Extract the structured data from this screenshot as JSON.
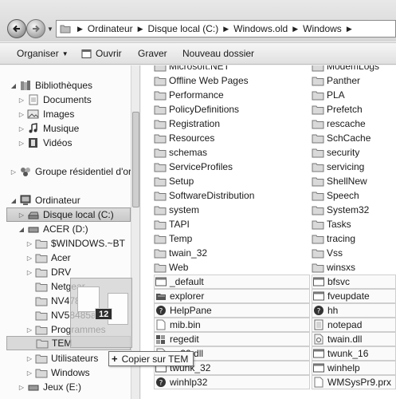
{
  "address": {
    "breadcrumbs": [
      "Ordinateur",
      "Disque local (C:)",
      "Windows.old",
      "Windows"
    ]
  },
  "toolbar": {
    "organize": "Organiser",
    "open": "Ouvrir",
    "burn": "Graver",
    "new_folder": "Nouveau dossier"
  },
  "nav": {
    "libraries": "Bibliothèques",
    "documents": "Documents",
    "images": "Images",
    "music": "Musique",
    "videos": "Vidéos",
    "homegroup": "Groupe résidentiel d'ordina",
    "computer": "Ordinateur",
    "local_disk": "Disque local (C:)",
    "acer": "ACER (D:)",
    "windows_bt": "$WINDOWS.~BT",
    "acer_folder": "Acer",
    "drv": "DRV",
    "netgear": "Netgear",
    "nv1": "NV478",
    "nv2": "NV58485a52",
    "programs": "Programmes",
    "tem": "TEM",
    "users": "Utilisateurs",
    "windows": "Windows",
    "games": "Jeux (E:)"
  },
  "files_col1": [
    {
      "name": "Microsoft.NET",
      "icon": "folder"
    },
    {
      "name": "Offline Web Pages",
      "icon": "folder"
    },
    {
      "name": "Performance",
      "icon": "folder"
    },
    {
      "name": "PolicyDefinitions",
      "icon": "folder"
    },
    {
      "name": "Registration",
      "icon": "folder"
    },
    {
      "name": "Resources",
      "icon": "folder"
    },
    {
      "name": "schemas",
      "icon": "folder"
    },
    {
      "name": "ServiceProfiles",
      "icon": "folder"
    },
    {
      "name": "Setup",
      "icon": "folder"
    },
    {
      "name": "SoftwareDistribution",
      "icon": "folder"
    },
    {
      "name": "system",
      "icon": "folder"
    },
    {
      "name": "TAPI",
      "icon": "folder"
    },
    {
      "name": "Temp",
      "icon": "folder"
    },
    {
      "name": "twain_32",
      "icon": "folder"
    },
    {
      "name": "Web",
      "icon": "folder"
    },
    {
      "name": "_default",
      "icon": "exe"
    },
    {
      "name": "explorer",
      "icon": "explorer"
    },
    {
      "name": "HelpPane",
      "icon": "help"
    },
    {
      "name": "mib.bin",
      "icon": "file"
    },
    {
      "name": "regedit",
      "icon": "regedit"
    },
    {
      "name": "n_32.dll",
      "icon": "dll"
    },
    {
      "name": "twunk_32",
      "icon": "exe"
    },
    {
      "name": "winhlp32",
      "icon": "help"
    }
  ],
  "files_col2": [
    {
      "name": "ModemLogs",
      "icon": "folder"
    },
    {
      "name": "Panther",
      "icon": "folder"
    },
    {
      "name": "PLA",
      "icon": "folder"
    },
    {
      "name": "Prefetch",
      "icon": "folder"
    },
    {
      "name": "rescache",
      "icon": "folder"
    },
    {
      "name": "SchCache",
      "icon": "folder"
    },
    {
      "name": "security",
      "icon": "folder"
    },
    {
      "name": "servicing",
      "icon": "folder"
    },
    {
      "name": "ShellNew",
      "icon": "folder"
    },
    {
      "name": "Speech",
      "icon": "folder"
    },
    {
      "name": "System32",
      "icon": "folder"
    },
    {
      "name": "Tasks",
      "icon": "folder"
    },
    {
      "name": "tracing",
      "icon": "folder"
    },
    {
      "name": "Vss",
      "icon": "folder"
    },
    {
      "name": "winsxs",
      "icon": "folder"
    },
    {
      "name": "bfsvc",
      "icon": "exe"
    },
    {
      "name": "fveupdate",
      "icon": "exe"
    },
    {
      "name": "hh",
      "icon": "help"
    },
    {
      "name": "notepad",
      "icon": "notepad"
    },
    {
      "name": "twain.dll",
      "icon": "dll"
    },
    {
      "name": "twunk_16",
      "icon": "exe"
    },
    {
      "name": "winhelp",
      "icon": "exe"
    },
    {
      "name": "WMSysPr9.prx",
      "icon": "file"
    }
  ],
  "drag": {
    "count": "12",
    "tooltip": "Copier sur TEM"
  }
}
